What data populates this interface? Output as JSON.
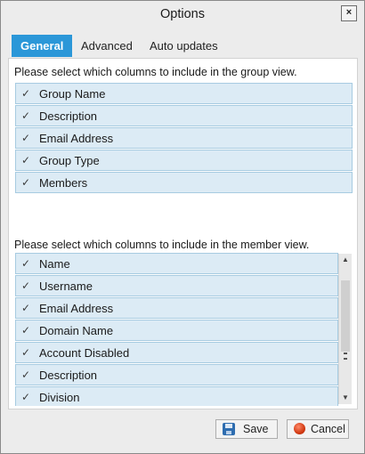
{
  "window": {
    "title": "Options",
    "close_glyph": "×"
  },
  "tabs": [
    {
      "label": "General",
      "active": true
    },
    {
      "label": "Advanced",
      "active": false
    },
    {
      "label": "Auto updates",
      "active": false
    }
  ],
  "group_section": {
    "hint": "Please select which columns to include in the group view.",
    "items": [
      {
        "label": "Group Name",
        "checked": true
      },
      {
        "label": "Description",
        "checked": true
      },
      {
        "label": "Email Address",
        "checked": true
      },
      {
        "label": "Group Type",
        "checked": true
      },
      {
        "label": "Members",
        "checked": true
      }
    ]
  },
  "member_section": {
    "hint": "Please select which columns to include in the member view.",
    "items": [
      {
        "label": "Name",
        "checked": true
      },
      {
        "label": "Username",
        "checked": true
      },
      {
        "label": "Email Address",
        "checked": true
      },
      {
        "label": "Domain Name",
        "checked": true
      },
      {
        "label": "Account Disabled",
        "checked": true
      },
      {
        "label": "Description",
        "checked": true
      },
      {
        "label": "Division",
        "checked": true
      }
    ]
  },
  "checkmark_glyph": "✓",
  "buttons": {
    "save": "Save",
    "cancel": "Cancel"
  },
  "icons": {
    "save": "floppy-disk-icon",
    "cancel": "red-circle-icon"
  },
  "colors": {
    "accent": "#2b97d8",
    "row_bg": "#dcebf5",
    "row_border": "#a7cbe1"
  }
}
